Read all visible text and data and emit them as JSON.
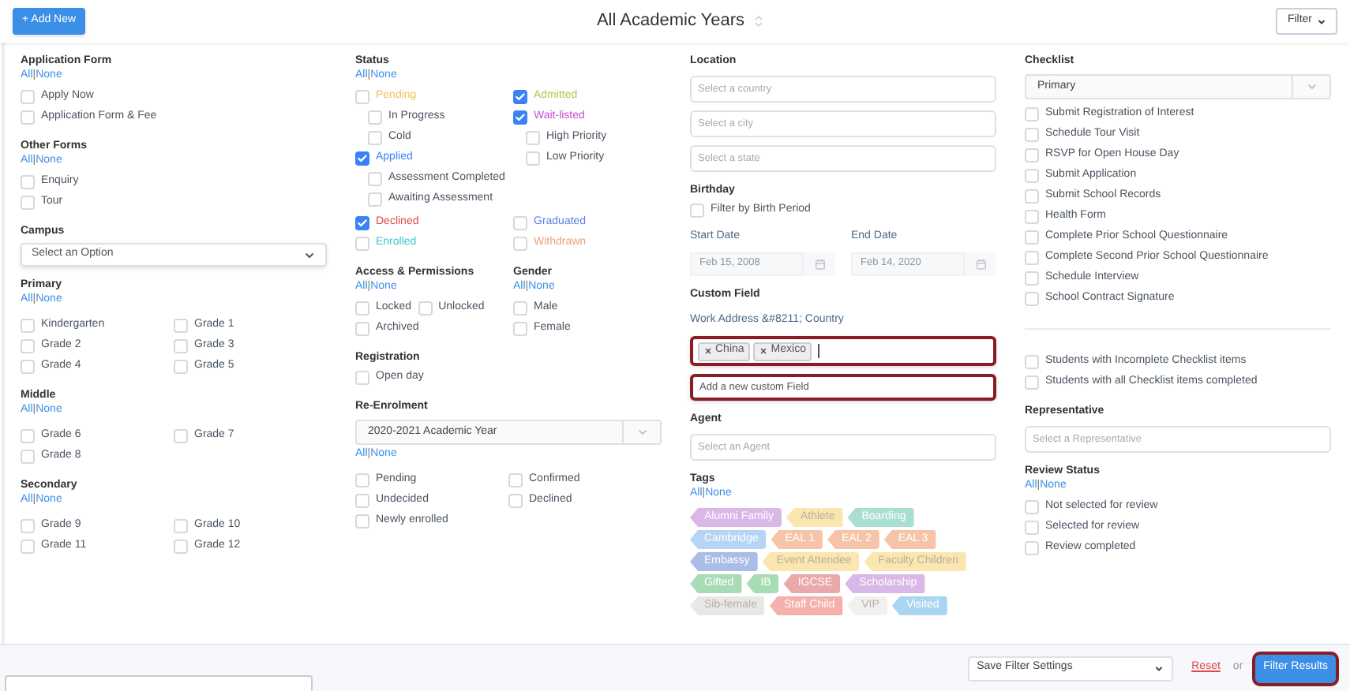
{
  "header": {
    "add_button": "+ Add New",
    "title": "All Academic Years",
    "filter_button": "Filter"
  },
  "columns": [
    [
      {
        "kind": "title",
        "text": "Application Form"
      },
      {
        "kind": "links",
        "items": [
          "All",
          "None"
        ],
        "separator": "|"
      },
      {
        "kind": "check_list",
        "items": [
          {
            "label": "Apply Now",
            "checked": false
          },
          {
            "label": "Application Form & Fee",
            "checked": false
          }
        ]
      },
      {
        "kind": "title",
        "text": "Other Forms"
      },
      {
        "kind": "links",
        "items": [
          "All",
          "None"
        ],
        "separator": "|"
      },
      {
        "kind": "check_list",
        "items": [
          {
            "label": "Enquiry",
            "checked": false
          },
          {
            "label": "Tour",
            "checked": false
          }
        ]
      },
      {
        "kind": "title",
        "text": "Campus"
      },
      {
        "kind": "select",
        "value": "Select an Option"
      },
      {
        "kind": "title",
        "text": "Primary"
      },
      {
        "kind": "links",
        "items": [
          "All",
          "None"
        ],
        "separator": "|"
      },
      {
        "kind": "check_grid",
        "items": [
          {
            "label": "Kindergarten",
            "checked": false
          },
          {
            "label": "Grade 1",
            "checked": false
          },
          {
            "label": "Grade 2",
            "checked": false
          },
          {
            "label": "Grade 3",
            "checked": false
          },
          {
            "label": "Grade 4",
            "checked": false
          },
          {
            "label": "Grade 5",
            "checked": false
          }
        ]
      },
      {
        "kind": "title",
        "text": "Middle"
      },
      {
        "kind": "links",
        "items": [
          "All",
          "None"
        ],
        "separator": "|"
      },
      {
        "kind": "check_grid",
        "items": [
          {
            "label": "Grade 6",
            "checked": false
          },
          {
            "label": "Grade 7",
            "checked": false
          },
          {
            "label": "Grade 8",
            "checked": false
          }
        ]
      },
      {
        "kind": "title",
        "text": "Secondary"
      },
      {
        "kind": "links",
        "items": [
          "All",
          "None"
        ],
        "separator": "|"
      },
      {
        "kind": "check_grid",
        "items": [
          {
            "label": "Grade 9",
            "checked": false
          },
          {
            "label": "Grade 10",
            "checked": false
          },
          {
            "label": "Grade 11",
            "checked": false
          },
          {
            "label": "Grade 12",
            "checked": false
          }
        ]
      }
    ],
    [
      {
        "kind": "title",
        "text": "Status"
      },
      {
        "kind": "links",
        "items": [
          "All",
          "None"
        ],
        "separator": "|"
      },
      {
        "kind": "pair",
        "parts": [
          [
            {
              "kind": "check_list",
              "items": [
                {
                  "label": "Pending",
                  "checked": false,
                  "color": "#f0c05a",
                  "children": [
                    {
                      "label": "In Progress",
                      "checked": false
                    },
                    {
                      "label": "Cold",
                      "checked": false
                    }
                  ]
                },
                {
                  "label": "Applied",
                  "checked": true,
                  "color": "#3b82f6",
                  "children": [
                    {
                      "label": "Assessment Completed",
                      "checked": false
                    },
                    {
                      "label": "Awaiting Assessment",
                      "checked": false
                    }
                  ]
                }
              ]
            }
          ],
          [
            {
              "kind": "check_list",
              "items": [
                {
                  "label": "Admitted",
                  "checked": true,
                  "color": "#b5c44a"
                },
                {
                  "label": "Wait-listed",
                  "checked": true,
                  "color": "#c24fd0",
                  "children": [
                    {
                      "label": "High Priority",
                      "checked": false
                    },
                    {
                      "label": "Low Priority",
                      "checked": false
                    }
                  ]
                }
              ]
            }
          ]
        ]
      },
      {
        "kind": "pair",
        "parts": [
          [
            {
              "kind": "check_list",
              "items": [
                {
                  "label": "Declined",
                  "checked": true,
                  "color": "#e04848"
                },
                {
                  "label": "Enrolled",
                  "checked": false,
                  "color": "#3fc6cf"
                }
              ]
            }
          ],
          [
            {
              "kind": "check_list",
              "items": [
                {
                  "label": "Graduated",
                  "checked": false,
                  "color": "#5b7fe0"
                },
                {
                  "label": "Withdrawn",
                  "checked": false,
                  "color": "#f0a080"
                }
              ]
            }
          ]
        ]
      },
      {
        "kind": "pair",
        "parts": [
          [
            {
              "kind": "title",
              "text": "Access & Permissions"
            },
            {
              "kind": "links",
              "items": [
                "All",
                "None"
              ],
              "separator": "|"
            },
            {
              "kind": "check_rows",
              "rows": [
                [
                  {
                    "label": "Locked",
                    "checked": false
                  },
                  {
                    "label": "Unlocked",
                    "checked": false
                  }
                ],
                [
                  {
                    "label": "Archived",
                    "checked": false
                  }
                ]
              ]
            }
          ],
          [
            {
              "kind": "title",
              "text": "Gender"
            },
            {
              "kind": "links",
              "items": [
                "All",
                "None"
              ],
              "separator": "|"
            },
            {
              "kind": "check_list",
              "items": [
                {
                  "label": "Male",
                  "checked": false
                },
                {
                  "label": "Female",
                  "checked": false
                }
              ]
            }
          ]
        ]
      },
      {
        "kind": "title",
        "text": "Registration"
      },
      {
        "kind": "check_list",
        "items": [
          {
            "label": "Open day",
            "checked": false
          }
        ]
      },
      {
        "kind": "title",
        "text": "Re-Enrolment"
      },
      {
        "kind": "addon_select",
        "value": "2020-2021 Academic Year"
      },
      {
        "kind": "links",
        "items": [
          "All",
          "None"
        ],
        "separator": "|"
      },
      {
        "kind": "check_grid",
        "items": [
          {
            "label": "Pending",
            "checked": false
          },
          {
            "label": "Confirmed",
            "checked": false
          },
          {
            "label": "Undecided",
            "checked": false
          },
          {
            "label": "Declined",
            "checked": false
          },
          {
            "label": "Newly enrolled",
            "checked": false
          }
        ]
      }
    ],
    [
      {
        "kind": "title",
        "text": "Location"
      },
      {
        "kind": "field",
        "placeholder": "Select a country"
      },
      {
        "kind": "field",
        "placeholder": "Select a city"
      },
      {
        "kind": "field",
        "placeholder": "Select a state"
      },
      {
        "kind": "title",
        "text": "Birthday"
      },
      {
        "kind": "check_list",
        "items": [
          {
            "label": "Filter by Birth Period",
            "checked": false
          }
        ]
      },
      {
        "kind": "dates",
        "items": [
          {
            "label": "Start Date",
            "value": "Feb 15, 2008",
            "disabled": true
          },
          {
            "label": "End Date",
            "value": "Feb 14, 2020",
            "disabled": true
          }
        ]
      },
      {
        "kind": "title",
        "text": "Custom Field"
      },
      {
        "kind": "custom_field",
        "label": "Work Address &#8211; Country",
        "chips": [
          "China",
          "Mexico"
        ],
        "highlighted": true
      },
      {
        "kind": "field",
        "value": "Add a new custom Field",
        "highlighted": true
      },
      {
        "kind": "title",
        "text": "Agent"
      },
      {
        "kind": "field",
        "placeholder": "Select an Agent"
      },
      {
        "kind": "title",
        "text": "Tags"
      },
      {
        "kind": "links",
        "items": [
          "All",
          "None"
        ],
        "separator": "|"
      },
      {
        "kind": "tags",
        "items": [
          {
            "label": "Alumni Family",
            "color": "#d9b8e8"
          },
          {
            "label": "Athlete",
            "color": "#fbe6b0"
          },
          {
            "label": "Boarding",
            "color": "#a8dfd0"
          },
          {
            "label": "Cambridge",
            "color": "#b7d3f5"
          },
          {
            "label": "EAL 1",
            "color": "#f6c4a8"
          },
          {
            "label": "EAL 2",
            "color": "#f6c4a8"
          },
          {
            "label": "EAL 3",
            "color": "#f6c4a8"
          },
          {
            "label": "Embassy",
            "color": "#a9bde6"
          },
          {
            "label": "Event Attendee",
            "color": "#fbe6b0"
          },
          {
            "label": "Faculty Children",
            "color": "#fbe6b0"
          },
          {
            "label": "Gifted",
            "color": "#a8dcb5"
          },
          {
            "label": "IB",
            "color": "#a8dcb5"
          },
          {
            "label": "IGCSE",
            "color": "#e9a9a9"
          },
          {
            "label": "Scholarship",
            "color": "#d9b8e8"
          },
          {
            "label": "Sib-female",
            "color": "#e8e8e8"
          },
          {
            "label": "Staff Child",
            "color": "#f5b0ad"
          },
          {
            "label": "VIP",
            "color": "#f0f0f0"
          },
          {
            "label": "Visited",
            "color": "#a9d5f2"
          }
        ]
      }
    ],
    [
      {
        "kind": "title",
        "text": "Checklist"
      },
      {
        "kind": "addon_select",
        "value": "Primary"
      },
      {
        "kind": "check_list",
        "items": [
          {
            "label": "Submit Registration of Interest",
            "checked": false
          },
          {
            "label": "Schedule Tour Visit",
            "checked": false
          },
          {
            "label": "RSVP for Open House Day",
            "checked": false
          },
          {
            "label": "Submit Application",
            "checked": false
          },
          {
            "label": "Submit School Records",
            "checked": false
          },
          {
            "label": "Health Form",
            "checked": false
          },
          {
            "label": "Complete Prior School Questionnaire",
            "checked": false
          },
          {
            "label": "Complete Second Prior School Questionnaire",
            "checked": false
          },
          {
            "label": "Schedule Interview",
            "checked": false
          },
          {
            "label": "School Contract Signature",
            "checked": false
          }
        ]
      },
      {
        "kind": "divider"
      },
      {
        "kind": "check_list",
        "items": [
          {
            "label": "Students with Incomplete Checklist items",
            "checked": false
          },
          {
            "label": "Students with all Checklist items completed",
            "checked": false
          }
        ]
      },
      {
        "kind": "title",
        "text": "Representative"
      },
      {
        "kind": "field",
        "placeholder": "Select a Representative"
      },
      {
        "kind": "title",
        "text": "Review Status"
      },
      {
        "kind": "links",
        "items": [
          "All",
          "None"
        ],
        "separator": "|"
      },
      {
        "kind": "check_list",
        "items": [
          {
            "label": "Not selected for review",
            "checked": false
          },
          {
            "label": "Selected for review",
            "checked": false
          },
          {
            "label": "Review completed",
            "checked": false
          }
        ]
      }
    ]
  ],
  "footer": {
    "save_select": "Save Filter Settings",
    "reset": "Reset",
    "or": "or",
    "filter_button": {
      "label": "Filter Results",
      "highlighted": true
    }
  }
}
